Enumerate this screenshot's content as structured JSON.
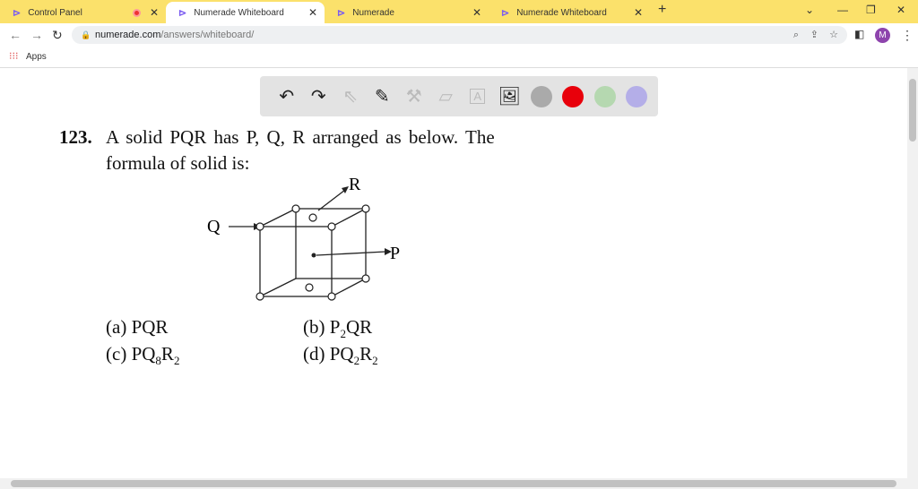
{
  "tabs": [
    {
      "title": "Control Panel",
      "active": false,
      "recording": true
    },
    {
      "title": "Numerade Whiteboard",
      "active": true
    },
    {
      "title": "Numerade",
      "active": false
    },
    {
      "title": "Numerade Whiteboard",
      "active": false
    }
  ],
  "new_tab": "+",
  "address": {
    "domain": "numerade.com",
    "path": "/answers/whiteboard/",
    "profile": "M"
  },
  "bookmarks": {
    "apps": "Apps"
  },
  "toolbar": {
    "colors": [
      "#aaaaaa",
      "#e8000b",
      "#b5d8b0",
      "#b4aee8"
    ]
  },
  "question": {
    "number": "123.",
    "line1": "A solid PQR has P, Q, R arranged as below. The",
    "line2": "formula of solid is:",
    "labels": {
      "q": "Q",
      "r": "R",
      "p": "P"
    },
    "options": [
      {
        "key": "(a)",
        "text": "PQR"
      },
      {
        "key": "(b)",
        "base": "P",
        "sub": "2",
        "rest": "QR"
      },
      {
        "key": "(c)",
        "base": "PQ",
        "sub": "8",
        "rest": "R",
        "sub2": "2"
      },
      {
        "key": "(d)",
        "base": "PQ",
        "sub": "2",
        "rest": "R",
        "sub2": "2"
      }
    ]
  }
}
